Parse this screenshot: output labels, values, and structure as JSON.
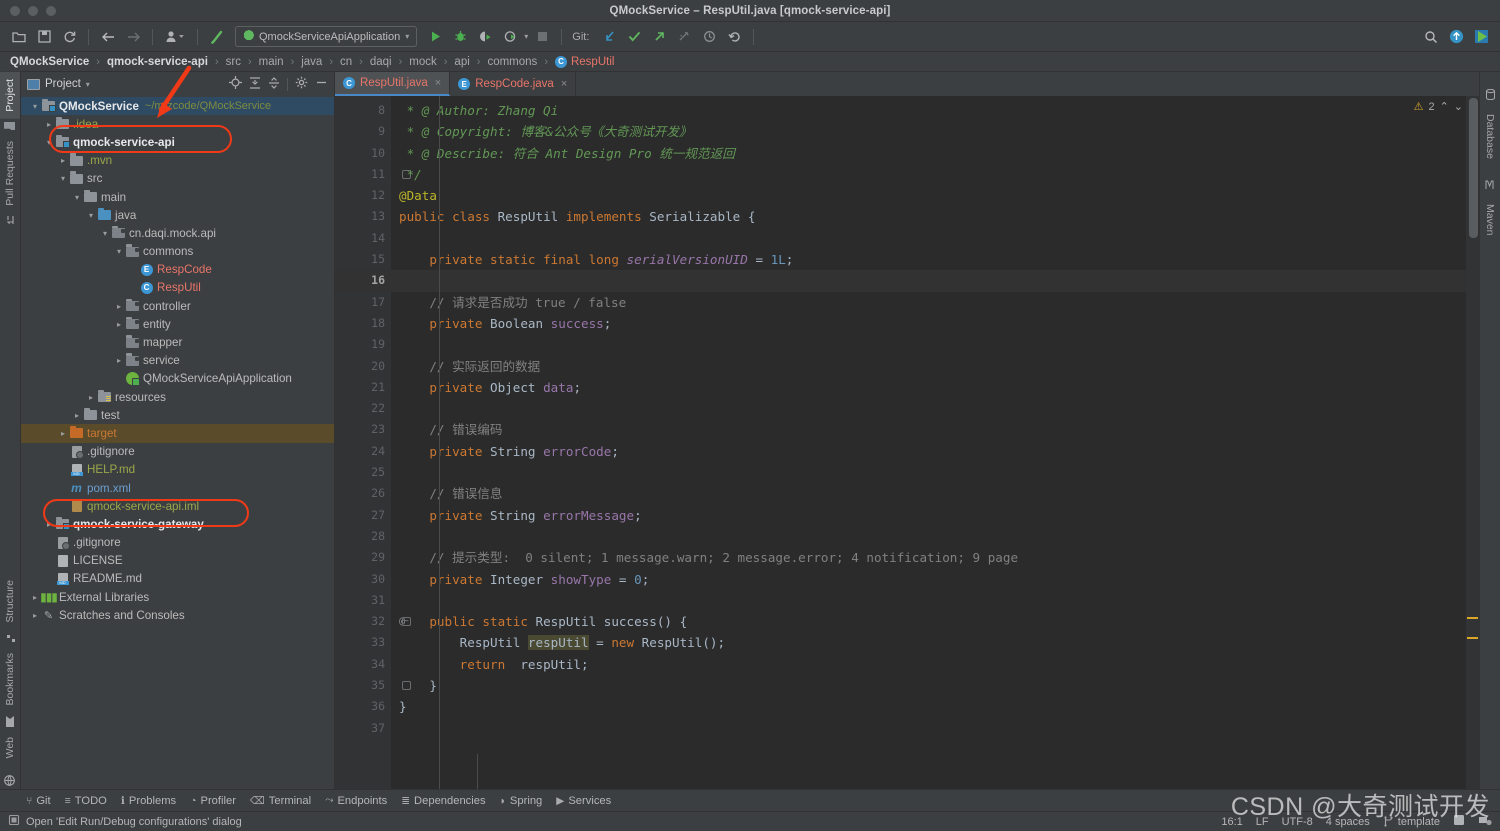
{
  "window": {
    "title": "QMockService – RespUtil.java [qmock-service-api]"
  },
  "toolbar": {
    "run_config_label": "QmockServiceApiApplication",
    "git_label": "Git:",
    "icons": [
      {
        "name": "open-folder-icon",
        "glyph": "📂"
      },
      {
        "name": "save-all-icon",
        "glyph": "💾"
      },
      {
        "name": "sync-icon",
        "glyph": "⟳"
      },
      {
        "name": "back-icon",
        "glyph": "←"
      },
      {
        "name": "forward-icon",
        "glyph": "→"
      },
      {
        "name": "profile-icon",
        "glyph": "👤"
      },
      {
        "name": "build-hammer-icon",
        "glyph": "╲"
      }
    ],
    "run_icons": [
      {
        "name": "run-icon",
        "glyph": "▶"
      },
      {
        "name": "debug-icon",
        "glyph": "🐞"
      },
      {
        "name": "run-coverage-icon",
        "glyph": "◑"
      },
      {
        "name": "profiler-run-icon",
        "glyph": "◷"
      },
      {
        "name": "stop-icon",
        "glyph": "■"
      }
    ],
    "git_icons": [
      {
        "name": "git-update-icon",
        "glyph": "↙"
      },
      {
        "name": "git-commit-icon",
        "glyph": "✓"
      },
      {
        "name": "git-push-icon",
        "glyph": "↗"
      },
      {
        "name": "git-branch-icon",
        "glyph": "⎇"
      },
      {
        "name": "git-history-icon",
        "glyph": "◴"
      },
      {
        "name": "git-rollback-icon",
        "glyph": "↶"
      }
    ],
    "right_icons": [
      {
        "name": "search-everywhere-icon",
        "glyph": "🔍"
      },
      {
        "name": "updates-available-icon",
        "glyph": "↑"
      },
      {
        "name": "ide-logo-icon",
        "glyph": "▶"
      }
    ]
  },
  "breadcrumb": {
    "items": [
      {
        "label": "QMockService",
        "bold": true
      },
      {
        "label": "qmock-service-api",
        "bold": true
      },
      {
        "label": "src",
        "bold": false
      },
      {
        "label": "main",
        "bold": false
      },
      {
        "label": "java",
        "bold": false
      },
      {
        "label": "cn",
        "bold": false
      },
      {
        "label": "daqi",
        "bold": false
      },
      {
        "label": "mock",
        "bold": false
      },
      {
        "label": "api",
        "bold": false
      },
      {
        "label": "commons",
        "bold": false
      }
    ],
    "class_badge": "C",
    "class_name": "RespUtil",
    "separator": "›"
  },
  "left_stripe": {
    "top": [
      {
        "label": "Project",
        "icon": "project-icon",
        "active": true
      },
      {
        "label": "Pull Requests",
        "icon": "pull-requests-icon",
        "active": false
      }
    ],
    "bottom": [
      {
        "label": "Structure",
        "icon": "structure-icon"
      },
      {
        "label": "Bookmarks",
        "icon": "bookmark-icon"
      },
      {
        "label": "Web",
        "icon": "web-icon"
      }
    ]
  },
  "right_stripe": {
    "items": [
      {
        "label": "Database",
        "icon": "database-icon"
      },
      {
        "label": "Maven",
        "icon": "maven-icon"
      }
    ]
  },
  "project_panel": {
    "title": "Project",
    "header_icons": [
      {
        "name": "locate-file-icon",
        "glyph": "⊕"
      },
      {
        "name": "expand-all-icon",
        "glyph": "⤓"
      },
      {
        "name": "collapse-all-icon",
        "glyph": "⤑"
      },
      {
        "name": "settings-gear-icon",
        "glyph": "⚙"
      },
      {
        "name": "hide-panel-icon",
        "glyph": "−"
      }
    ],
    "tree": [
      {
        "depth": 0,
        "arrow": "open",
        "icon": "project-root-folder",
        "label": "QMockService",
        "bold": true,
        "suffix": "~/mrzcode/QMockService",
        "selected": true
      },
      {
        "depth": 1,
        "arrow": "closed",
        "icon": "folder",
        "label": ".idea",
        "color": "yellow"
      },
      {
        "depth": 1,
        "arrow": "open",
        "icon": "module-folder",
        "label": "qmock-service-api",
        "bold": true
      },
      {
        "depth": 2,
        "arrow": "closed",
        "icon": "folder",
        "label": ".mvn",
        "color": "yellow"
      },
      {
        "depth": 2,
        "arrow": "open",
        "icon": "folder",
        "label": "src"
      },
      {
        "depth": 3,
        "arrow": "open",
        "icon": "folder",
        "label": "main"
      },
      {
        "depth": 4,
        "arrow": "open",
        "icon": "source-folder",
        "label": "java"
      },
      {
        "depth": 5,
        "arrow": "open",
        "icon": "package-folder",
        "label": "cn.daqi.mock.api"
      },
      {
        "depth": 6,
        "arrow": "open",
        "icon": "package-folder",
        "label": "commons"
      },
      {
        "depth": 7,
        "arrow": "none",
        "icon": "enum-badge",
        "label": "RespCode",
        "color": "red"
      },
      {
        "depth": 7,
        "arrow": "none",
        "icon": "class-badge",
        "label": "RespUtil",
        "color": "red"
      },
      {
        "depth": 6,
        "arrow": "closed",
        "icon": "package-folder",
        "label": "controller"
      },
      {
        "depth": 6,
        "arrow": "closed",
        "icon": "package-folder",
        "label": "entity"
      },
      {
        "depth": 6,
        "arrow": "none",
        "icon": "package-folder",
        "label": "mapper"
      },
      {
        "depth": 6,
        "arrow": "closed",
        "icon": "package-folder",
        "label": "service"
      },
      {
        "depth": 6,
        "arrow": "none",
        "icon": "spring-class",
        "label": "QMockServiceApiApplication"
      },
      {
        "depth": 4,
        "arrow": "closed",
        "icon": "resources-folder",
        "label": "resources"
      },
      {
        "depth": 3,
        "arrow": "closed",
        "icon": "folder",
        "label": "test"
      },
      {
        "depth": 2,
        "arrow": "closed",
        "icon": "excluded-folder",
        "label": "target",
        "color": "orange",
        "highlight": true
      },
      {
        "depth": 2,
        "arrow": "none",
        "icon": "gitignore-file",
        "label": ".gitignore"
      },
      {
        "depth": 2,
        "arrow": "none",
        "icon": "markdown-file",
        "label": "HELP.md",
        "color": "yellow"
      },
      {
        "depth": 2,
        "arrow": "none",
        "icon": "maven-file",
        "label": "pom.xml",
        "color": "blue"
      },
      {
        "depth": 2,
        "arrow": "none",
        "icon": "iml-file",
        "label": "qmock-service-api.iml",
        "color": "yellow"
      },
      {
        "depth": 1,
        "arrow": "closed",
        "icon": "module-folder",
        "label": "qmock-service-gateway",
        "bold": true
      },
      {
        "depth": 1,
        "arrow": "none",
        "icon": "gitignore-file",
        "label": ".gitignore"
      },
      {
        "depth": 1,
        "arrow": "none",
        "icon": "text-file",
        "label": "LICENSE"
      },
      {
        "depth": 1,
        "arrow": "none",
        "icon": "markdown-file",
        "label": "README.md"
      },
      {
        "depth": 0,
        "arrow": "closed",
        "icon": "libraries-icon",
        "label": "External Libraries"
      },
      {
        "depth": 0,
        "arrow": "closed",
        "icon": "scratches-icon",
        "label": "Scratches and Consoles"
      }
    ]
  },
  "editor": {
    "tabs": [
      {
        "label": "RespUtil.java",
        "badge": "C",
        "active": true,
        "close": "×"
      },
      {
        "label": "RespCode.java",
        "badge": "E",
        "active": false,
        "close": "×"
      }
    ],
    "inspection": {
      "warn_icon": "⚠",
      "warn_count": "2",
      "up": "⌃",
      "down": "⌄"
    },
    "first_line_number": 8,
    "current_line": 16,
    "lines": [
      {
        "n": 8,
        "tokens": [
          {
            "t": " * @ Author: Zhang Qi",
            "c": "jd"
          }
        ]
      },
      {
        "n": 9,
        "tokens": [
          {
            "t": " * @ Copyright: 博客&公众号《大奇测试开发》",
            "c": "jd"
          }
        ]
      },
      {
        "n": 10,
        "tokens": [
          {
            "t": " * @ Describe: 符合 Ant Design Pro 统一规范返回",
            "c": "jd"
          }
        ]
      },
      {
        "n": 11,
        "fold": "end",
        "tokens": [
          {
            "t": " */",
            "c": "jd"
          }
        ]
      },
      {
        "n": 12,
        "tokens": [
          {
            "t": "@Data",
            "c": "ann"
          }
        ]
      },
      {
        "n": 13,
        "tokens": [
          {
            "t": "public",
            "c": "kw"
          },
          {
            "t": " ",
            "c": ""
          },
          {
            "t": "class",
            "c": "kw"
          },
          {
            "t": " RespUtil ",
            "c": "typ"
          },
          {
            "t": "implements",
            "c": "kw"
          },
          {
            "t": " Serializable {",
            "c": "typ"
          }
        ]
      },
      {
        "n": 14,
        "tokens": []
      },
      {
        "n": 15,
        "tokens": [
          {
            "t": "    ",
            "c": ""
          },
          {
            "t": "private static final",
            "c": "kw"
          },
          {
            "t": " ",
            "c": ""
          },
          {
            "t": "long",
            "c": "kw"
          },
          {
            "t": " ",
            "c": ""
          },
          {
            "t": "serialVersionUID",
            "c": "fldi"
          },
          {
            "t": " = ",
            "c": "typ"
          },
          {
            "t": "1L",
            "c": "num"
          },
          {
            "t": ";",
            "c": "typ"
          }
        ]
      },
      {
        "n": 16,
        "tokens": []
      },
      {
        "n": 17,
        "tokens": [
          {
            "t": "    // 请求是否成功 true / false",
            "c": "cmt"
          }
        ]
      },
      {
        "n": 18,
        "tokens": [
          {
            "t": "    ",
            "c": ""
          },
          {
            "t": "private",
            "c": "kw"
          },
          {
            "t": " Boolean ",
            "c": "typ"
          },
          {
            "t": "success",
            "c": "fld"
          },
          {
            "t": ";",
            "c": "typ"
          }
        ]
      },
      {
        "n": 19,
        "tokens": []
      },
      {
        "n": 20,
        "tokens": [
          {
            "t": "    // 实际返回的数据",
            "c": "cmt"
          }
        ]
      },
      {
        "n": 21,
        "tokens": [
          {
            "t": "    ",
            "c": ""
          },
          {
            "t": "private",
            "c": "kw"
          },
          {
            "t": " Object ",
            "c": "typ"
          },
          {
            "t": "data",
            "c": "fld"
          },
          {
            "t": ";",
            "c": "typ"
          }
        ]
      },
      {
        "n": 22,
        "tokens": []
      },
      {
        "n": 23,
        "tokens": [
          {
            "t": "    // 错误编码",
            "c": "cmt"
          }
        ]
      },
      {
        "n": 24,
        "tokens": [
          {
            "t": "    ",
            "c": ""
          },
          {
            "t": "private",
            "c": "kw"
          },
          {
            "t": " String ",
            "c": "typ"
          },
          {
            "t": "errorCode",
            "c": "fld"
          },
          {
            "t": ";",
            "c": "typ"
          }
        ]
      },
      {
        "n": 25,
        "tokens": []
      },
      {
        "n": 26,
        "tokens": [
          {
            "t": "    // 错误信息",
            "c": "cmt"
          }
        ]
      },
      {
        "n": 27,
        "tokens": [
          {
            "t": "    ",
            "c": ""
          },
          {
            "t": "private",
            "c": "kw"
          },
          {
            "t": " String ",
            "c": "typ"
          },
          {
            "t": "errorMessage",
            "c": "fld"
          },
          {
            "t": ";",
            "c": "typ"
          }
        ]
      },
      {
        "n": 28,
        "tokens": []
      },
      {
        "n": 29,
        "tokens": [
          {
            "t": "    // 提示类型:  0 silent; 1 message.warn; 2 message.error; 4 notification; 9 page",
            "c": "cmt"
          }
        ]
      },
      {
        "n": 30,
        "tokens": [
          {
            "t": "    ",
            "c": ""
          },
          {
            "t": "private",
            "c": "kw"
          },
          {
            "t": " Integer ",
            "c": "typ"
          },
          {
            "t": "showType",
            "c": "fld"
          },
          {
            "t": " = ",
            "c": "typ"
          },
          {
            "t": "0",
            "c": "num"
          },
          {
            "t": ";",
            "c": "typ"
          }
        ]
      },
      {
        "n": 31,
        "tokens": []
      },
      {
        "n": 32,
        "gutter_mark": "@",
        "fold": "start",
        "tokens": [
          {
            "t": "    ",
            "c": ""
          },
          {
            "t": "public static",
            "c": "kw"
          },
          {
            "t": " RespUtil ",
            "c": "typ"
          },
          {
            "t": "success",
            "c": "mth"
          },
          {
            "t": "() {",
            "c": "typ"
          }
        ]
      },
      {
        "n": 33,
        "tokens": [
          {
            "t": "        RespUtil ",
            "c": "typ"
          },
          {
            "t": "respUtil",
            "c": "hl"
          },
          {
            "t": " = ",
            "c": "typ"
          },
          {
            "t": "new",
            "c": "kw"
          },
          {
            "t": " RespUtil();",
            "c": "typ"
          }
        ]
      },
      {
        "n": 34,
        "tokens": [
          {
            "t": "        ",
            "c": ""
          },
          {
            "t": "return",
            "c": "kw"
          },
          {
            "t": "  respUtil;",
            "c": "typ"
          }
        ]
      },
      {
        "n": 35,
        "fold": "end",
        "tokens": [
          {
            "t": "    }",
            "c": "typ"
          }
        ]
      },
      {
        "n": 36,
        "tokens": [
          {
            "t": "}",
            "c": "typ"
          }
        ]
      },
      {
        "n": 37,
        "tokens": []
      }
    ]
  },
  "tool_windows": [
    {
      "label": "Git",
      "icon": "git-branch-icon",
      "glyph": "⑂"
    },
    {
      "label": "TODO",
      "icon": "todo-list-icon",
      "glyph": "≡"
    },
    {
      "label": "Problems",
      "icon": "problems-icon",
      "glyph": "ℹ"
    },
    {
      "label": "Profiler",
      "icon": "profiler-icon",
      "glyph": "◔"
    },
    {
      "label": "Terminal",
      "icon": "terminal-icon",
      "glyph": "⌫"
    },
    {
      "label": "Endpoints",
      "icon": "endpoints-icon",
      "glyph": "⤳"
    },
    {
      "label": "Dependencies",
      "icon": "dependencies-icon",
      "glyph": "≣"
    },
    {
      "label": "Spring",
      "icon": "spring-leaf-icon",
      "glyph": "◗"
    },
    {
      "label": "Services",
      "icon": "services-icon",
      "glyph": "▶"
    }
  ],
  "status_bar": {
    "left_icon": "memory-indicator-icon",
    "message": "Open 'Edit Run/Debug configurations' dialog",
    "caret_position": "16:1",
    "line_separator": "LF",
    "encoding": "UTF-8",
    "indent": "4 spaces",
    "branch_icon": "git-branch-icon",
    "branch": "template",
    "inspection_icon": "inspections-icon",
    "notifications_icon": "notifications-icon"
  },
  "annotations": {
    "highlight_color": "#f03a17",
    "boxes": [
      {
        "name": "qmock-service-api-highlight"
      },
      {
        "name": "qmock-service-gateway-highlight"
      }
    ],
    "arrow": {
      "name": "pointer-arrow-to-project-root"
    }
  },
  "watermark": {
    "text": "CSDN @大奇测试开发"
  }
}
